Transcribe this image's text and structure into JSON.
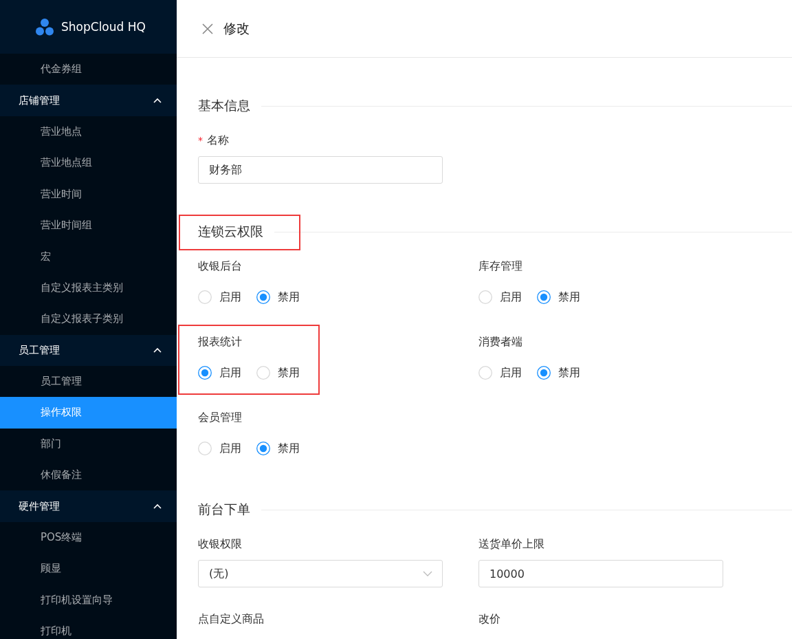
{
  "brand": {
    "name": "ShopCloud HQ"
  },
  "sidebar": {
    "items": [
      {
        "kind": "item",
        "label": "代金券组",
        "selected": false
      },
      {
        "kind": "group",
        "label": "店铺管理",
        "expanded": true,
        "children": [
          {
            "kind": "item",
            "label": "营业地点",
            "selected": false
          },
          {
            "kind": "item",
            "label": "营业地点组",
            "selected": false
          },
          {
            "kind": "item",
            "label": "营业时间",
            "selected": false
          },
          {
            "kind": "item",
            "label": "营业时间组",
            "selected": false
          },
          {
            "kind": "item",
            "label": "宏",
            "selected": false
          },
          {
            "kind": "item",
            "label": "自定义报表主类别",
            "selected": false
          },
          {
            "kind": "item",
            "label": "自定义报表子类别",
            "selected": false
          }
        ]
      },
      {
        "kind": "group",
        "label": "员工管理",
        "expanded": true,
        "children": [
          {
            "kind": "item",
            "label": "员工管理",
            "selected": false
          },
          {
            "kind": "item",
            "label": "操作权限",
            "selected": true
          },
          {
            "kind": "item",
            "label": "部门",
            "selected": false
          },
          {
            "kind": "item",
            "label": "休假备注",
            "selected": false
          }
        ]
      },
      {
        "kind": "group",
        "label": "硬件管理",
        "expanded": true,
        "children": [
          {
            "kind": "item",
            "label": "POS终端",
            "selected": false
          },
          {
            "kind": "item",
            "label": "顾显",
            "selected": false
          },
          {
            "kind": "item",
            "label": "打印机设置向导",
            "selected": false
          },
          {
            "kind": "item",
            "label": "打印机",
            "selected": false
          }
        ]
      }
    ]
  },
  "drawer": {
    "title": "修改"
  },
  "sections": [
    {
      "title": "基本信息",
      "highlighted": false,
      "kind": "fields",
      "fields": [
        {
          "kind": "input",
          "required_mark": "*",
          "label": "名称",
          "value": "财务部"
        }
      ]
    },
    {
      "title": "连锁云权限",
      "highlighted": true,
      "kind": "permissions",
      "permissions": [
        {
          "label": "收银后台",
          "highlighted": false,
          "options": [
            {
              "label": "启用",
              "selected": false
            },
            {
              "label": "禁用",
              "selected": true
            }
          ]
        },
        {
          "label": "库存管理",
          "highlighted": false,
          "options": [
            {
              "label": "启用",
              "selected": false
            },
            {
              "label": "禁用",
              "selected": true
            }
          ]
        },
        {
          "label": "报表统计",
          "highlighted": true,
          "options": [
            {
              "label": "启用",
              "selected": true
            },
            {
              "label": "禁用",
              "selected": false
            }
          ]
        },
        {
          "label": "消费者端",
          "highlighted": false,
          "options": [
            {
              "label": "启用",
              "selected": false
            },
            {
              "label": "禁用",
              "selected": true
            }
          ]
        },
        {
          "label": "会员管理",
          "highlighted": false,
          "options": [
            {
              "label": "启用",
              "selected": false
            },
            {
              "label": "禁用",
              "selected": true
            }
          ]
        }
      ]
    },
    {
      "title": "前台下单",
      "highlighted": false,
      "kind": "fields",
      "fields": [
        {
          "kind": "select",
          "label": "收银权限",
          "value": "(无)"
        },
        {
          "kind": "input",
          "label": "送货单价上限",
          "value": "10000"
        },
        {
          "kind": "label",
          "label": "点自定义商品"
        },
        {
          "kind": "label",
          "label": "改价"
        }
      ]
    }
  ]
}
